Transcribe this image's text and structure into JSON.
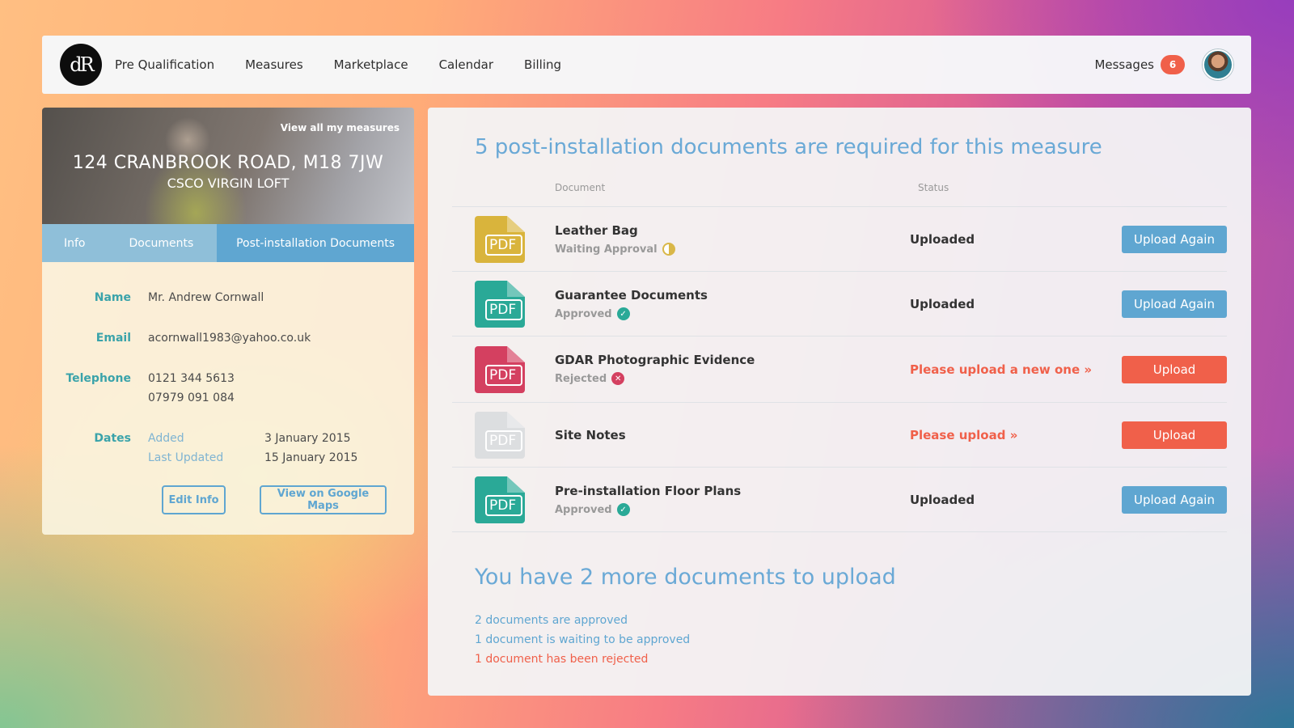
{
  "nav": {
    "logo_text": "dR",
    "items": [
      "Pre Qualification",
      "Measures",
      "Marketplace",
      "Calendar",
      "Billing"
    ],
    "messages_label": "Messages",
    "messages_count": "6"
  },
  "property": {
    "view_all_link": "View all my measures",
    "address": "124 CRANBROOK ROAD, M18 7JW",
    "measure": "CSCO VIRGIN LOFT",
    "tabs": [
      "Info",
      "Documents",
      "Post-installation Documents"
    ],
    "active_tab": "Post-installation Documents"
  },
  "info": {
    "name_label": "Name",
    "name": "Mr. Andrew Cornwall",
    "email_label": "Email",
    "email": "acornwall1983@yahoo.co.uk",
    "telephone_label": "Telephone",
    "telephone_1": "0121 344 5613",
    "telephone_2": "07979 091 084",
    "dates_label": "Dates",
    "added_label": "Added",
    "added": "3 January 2015",
    "updated_label": "Last Updated",
    "updated": "15 January 2015",
    "edit_button": "Edit Info",
    "maps_button": "View on Google Maps"
  },
  "documents": {
    "title": "5 post-installation documents are required for this measure",
    "col_document": "Document",
    "col_status": "Status",
    "rows": [
      {
        "name": "Leather Bag",
        "state": "Waiting Approval",
        "status": "Uploaded",
        "action": "Upload Again",
        "icon_color": "#d9b43c",
        "state_kind": "waiting",
        "alert": false
      },
      {
        "name": "Guarantee Documents",
        "state": "Approved",
        "status": "Uploaded",
        "action": "Upload Again",
        "icon_color": "#2aa997",
        "state_kind": "approved",
        "alert": false
      },
      {
        "name": "GDAR Photographic Evidence",
        "state": "Rejected",
        "status": "Please upload a new one »",
        "action": "Upload",
        "icon_color": "#d44060",
        "state_kind": "rejected",
        "alert": true
      },
      {
        "name": "Site Notes",
        "state": "",
        "status": "Please upload »",
        "action": "Upload",
        "icon_color": "#dcdee0",
        "state_kind": "none",
        "alert": true
      },
      {
        "name": "Pre-installation Floor Plans",
        "state": "Approved",
        "status": "Uploaded",
        "action": "Upload Again",
        "icon_color": "#2aa997",
        "state_kind": "approved",
        "alert": false
      }
    ],
    "pdf_label": "PDF"
  },
  "summary": {
    "title": "You have 2 more documents to upload",
    "approved": "2 documents are approved",
    "waiting": "1 document is waiting to be approved",
    "rejected": "1 document has been rejected"
  },
  "colors": {
    "accent": "#5fa6d1",
    "danger": "#f0604a",
    "teal": "#3aa3aa"
  }
}
